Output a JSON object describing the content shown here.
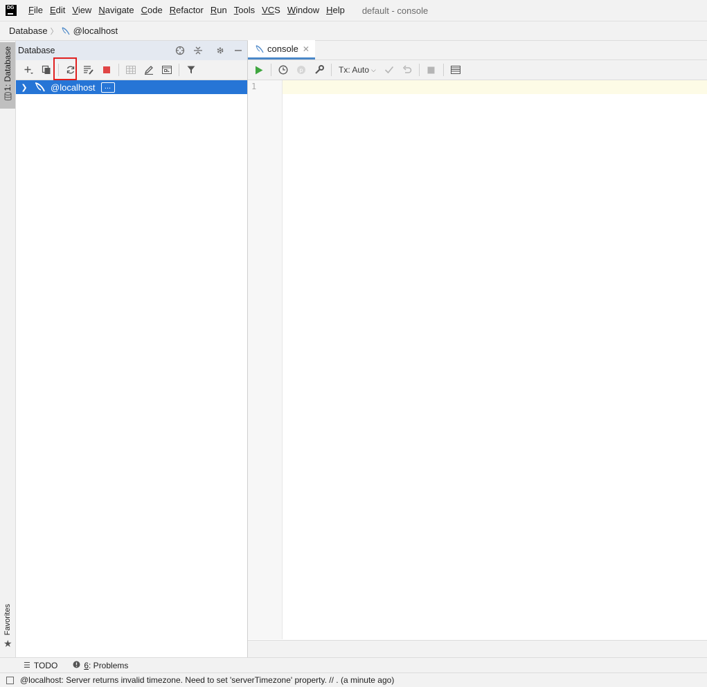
{
  "menubar": {
    "items": [
      {
        "label": "File",
        "mnemonic": "F",
        "rest": "ile"
      },
      {
        "label": "Edit",
        "mnemonic": "E",
        "rest": "dit"
      },
      {
        "label": "View",
        "mnemonic": "V",
        "rest": "iew"
      },
      {
        "label": "Navigate",
        "mnemonic": "N",
        "rest": "avigate"
      },
      {
        "label": "Code",
        "mnemonic": "C",
        "rest": "ode"
      },
      {
        "label": "Refactor",
        "mnemonic": "R",
        "rest": "efactor"
      },
      {
        "label": "Run",
        "mnemonic": "R",
        "rest": "un"
      },
      {
        "label": "Tools",
        "mnemonic": "T",
        "rest": "ools"
      },
      {
        "label": "VCS",
        "mnemonic": "VC",
        "rest": "S"
      },
      {
        "label": "Window",
        "mnemonic": "W",
        "rest": "indow"
      },
      {
        "label": "Help",
        "mnemonic": "H",
        "rest": "elp"
      }
    ],
    "window_title": "default - console",
    "logo_text": "DG"
  },
  "breadcrumb": {
    "root": "Database",
    "current": "@localhost"
  },
  "left_strip": {
    "database_tab": "1: Database",
    "favorites_tab": "Favorites"
  },
  "db_panel": {
    "title": "Database",
    "tree": [
      {
        "label": "@localhost",
        "badge": "..."
      }
    ]
  },
  "editor": {
    "tab_label": "console",
    "tx_mode": "Tx: Auto",
    "line_numbers": [
      "1"
    ]
  },
  "bottom_tools": {
    "todo": "TODO",
    "problems_num": "6",
    "problems_label": ": Problems"
  },
  "status": {
    "message": "@localhost: Server returns invalid timezone. Need to set 'serverTimezone' property. // . (a minute ago)"
  },
  "colors": {
    "selection": "#2675d6",
    "highlight_box": "#e02020",
    "run_green": "#3fa63f",
    "stop_red": "#e04545",
    "current_line": "#fdfbe6"
  }
}
